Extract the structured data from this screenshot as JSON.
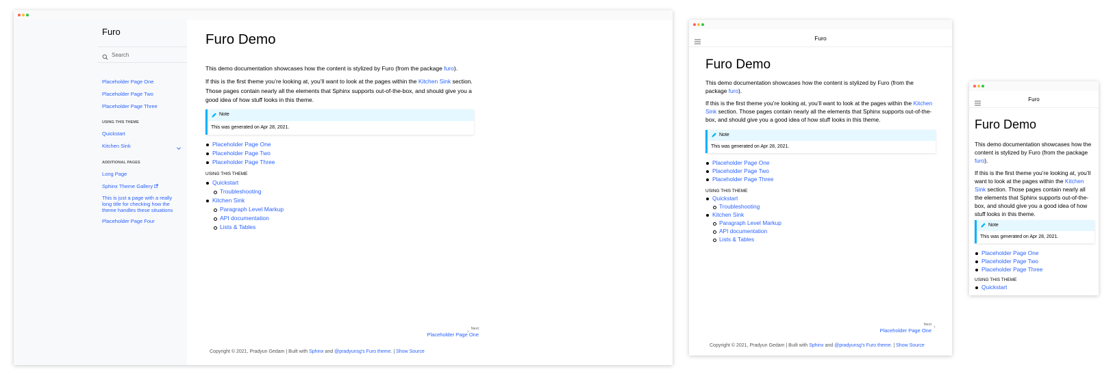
{
  "window_controls": {
    "colors": {
      "close": "#ff5f57",
      "minimize": "#febc2e",
      "zoom": "#28c840"
    }
  },
  "accent_color": "#2962ff",
  "note_color": "#00b0ff",
  "site": {
    "brand": "Furo",
    "search_placeholder": "Search",
    "nav": {
      "top": [
        "Placeholder Page One",
        "Placeholder Page Two",
        "Placeholder Page Three"
      ],
      "caption_using": "USING THIS THEME",
      "using": [
        "Quickstart",
        "Kitchen Sink"
      ],
      "caption_additional": "ADDITIONAL PAGES",
      "additional": {
        "long_page": "Long Page",
        "gallery": "Sphinx Theme Gallery",
        "long_title": "This is just a page with a really long title for checking how the theme handles these situations",
        "page_four": "Placeholder Page Four"
      }
    },
    "icons": {
      "search": "search-icon",
      "expand": "chevron-down-icon",
      "external": "external-link-icon",
      "menu": "menu-icon",
      "note": "pencil-icon",
      "next": "chevron-right-icon"
    }
  },
  "content": {
    "title": "Furo Demo",
    "p1_text": "This demo documentation showcases how the content is stylized by Furo (from the package ",
    "p1_link": "furo",
    "p1_end": ").",
    "p2_text": "If this is the first theme you’re looking at, you’ll want to look at the pages within the ",
    "p2_link": "Kitchen Sink",
    "p2_end": " section. Those pages contain nearly all the elements that Sphinx supports out-of-the-box, and should give you a good idea of how stuff looks in this theme.",
    "note": {
      "title": "Note",
      "body": "This was generated on Apr 28, 2021."
    },
    "toc": {
      "top": [
        "Placeholder Page One",
        "Placeholder Page Two",
        "Placeholder Page Three"
      ],
      "caption": "USING THIS THEME",
      "quickstart": "Quickstart",
      "troubleshooting": "Troubleshooting",
      "kitchen_sink": "Kitchen Sink",
      "ks_children": [
        "Paragraph Level Markup",
        "API documentation",
        "Lists & Tables"
      ]
    },
    "next": {
      "label": "Next",
      "title": "Placeholder Page One"
    },
    "footer": {
      "copyright": "Copyright © 2021, Pradyun Gedam | Built with ",
      "sphinx": "Sphinx",
      "and": " and ",
      "theme": "@pradyunsg's Furo theme.",
      "sep": " | ",
      "source": "Show Source"
    }
  }
}
